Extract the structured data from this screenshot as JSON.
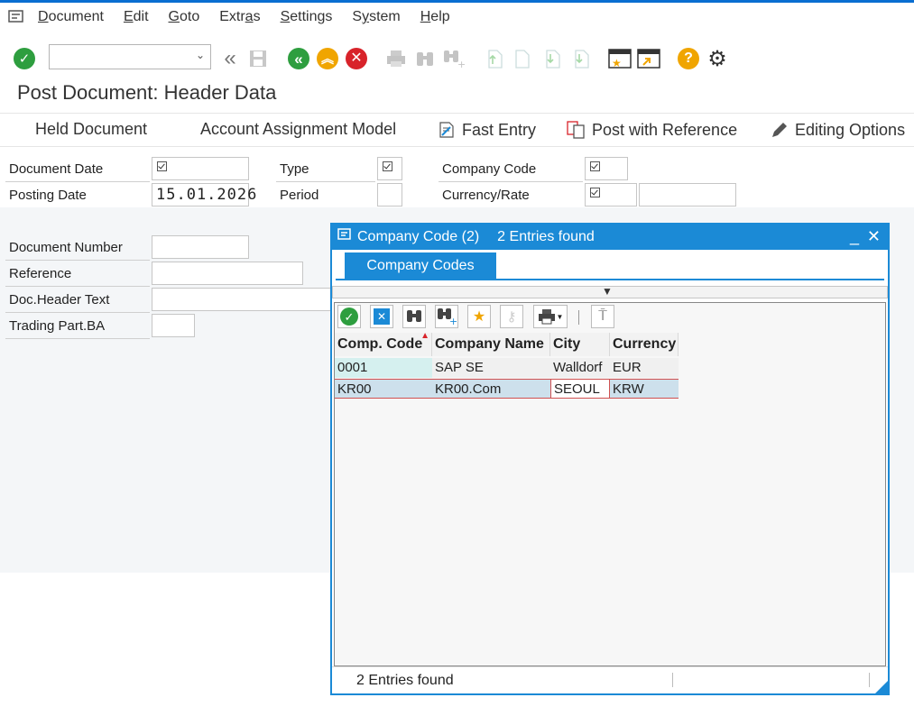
{
  "menu": {
    "items": [
      {
        "label": "Document",
        "accel": "D"
      },
      {
        "label": "Edit",
        "accel": "E"
      },
      {
        "label": "Goto",
        "accel": "G"
      },
      {
        "label": "Extras",
        "accel": "a"
      },
      {
        "label": "Settings",
        "accel": "S"
      },
      {
        "label": "System",
        "accel": "y"
      },
      {
        "label": "Help",
        "accel": "H"
      }
    ]
  },
  "toolbar": {
    "command_field_value": "",
    "icons": [
      "enter-icon",
      "back-arrows-icon",
      "save-icon",
      "back-icon",
      "exit-icon",
      "cancel-icon",
      "print-icon",
      "find-icon",
      "find-next-icon",
      "first-page-icon",
      "previous-page-icon",
      "next-page-icon",
      "last-page-icon",
      "create-session-icon",
      "shortcut-icon",
      "help-icon",
      "settings-icon"
    ]
  },
  "page": {
    "title": "Post Document: Header Data"
  },
  "appbar": {
    "held_document": "Held Document",
    "account_assignment_model": "Account Assignment Model",
    "fast_entry": "Fast Entry",
    "post_with_reference": "Post with Reference",
    "editing_options": "Editing Options"
  },
  "form": {
    "document_date_label": "Document Date",
    "posting_date_label": "Posting Date",
    "posting_date_value": "15.01.2026",
    "type_label": "Type",
    "period_label": "Period",
    "company_code_label": "Company Code",
    "currency_rate_label": "Currency/Rate",
    "document_number_label": "Document Number",
    "reference_label": "Reference",
    "doc_header_text_label": "Doc.Header Text",
    "trading_part_label": "Trading Part.BA"
  },
  "dialog": {
    "title": "Company Code (2)",
    "subtitle": "2 Entries found",
    "tab": "Company Codes",
    "columns": [
      "Comp. Code",
      "Company Name",
      "City",
      "Currency"
    ],
    "rows": [
      [
        "0001",
        "SAP SE",
        "Walldorf",
        "EUR"
      ],
      [
        "KR00",
        "KR00.Com",
        "SEOUL",
        "KRW"
      ]
    ],
    "status": "2 Entries found"
  },
  "colors": {
    "accent": "#1b8ad6",
    "enter_green": "#2e9e3f",
    "back_green": "#2e9e3f",
    "exit_orange": "#f0a500",
    "cancel_red": "#d8232a",
    "help_yellow": "#f0a500"
  }
}
